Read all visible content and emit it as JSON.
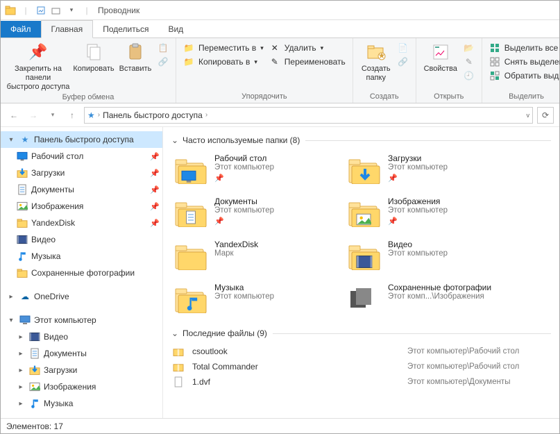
{
  "title": "Проводник",
  "tabs": {
    "file": "Файл",
    "home": "Главная",
    "share": "Поделиться",
    "view": "Вид"
  },
  "ribbon": {
    "clipboard": {
      "label": "Буфер обмена",
      "pin": "Закрепить на панели\nбыстрого доступа",
      "copy": "Копировать",
      "paste": "Вставить"
    },
    "organize": {
      "label": "Упорядочить",
      "move": "Переместить в",
      "copyto": "Копировать в",
      "delete": "Удалить",
      "rename": "Переименовать"
    },
    "new": {
      "label": "Создать",
      "newfolder": "Создать\nпапку"
    },
    "open": {
      "label": "Открыть",
      "props": "Свойства"
    },
    "select": {
      "label": "Выделить",
      "all": "Выделить все",
      "none": "Снять выделен",
      "invert": "Обратить выд"
    }
  },
  "breadcrumb": {
    "root": "Панель быстрого доступа"
  },
  "nav": {
    "quick": {
      "label": "Панель быстрого доступа",
      "items": [
        {
          "name": "Рабочий стол",
          "icon": "desktop",
          "pin": true
        },
        {
          "name": "Загрузки",
          "icon": "downloads",
          "pin": true
        },
        {
          "name": "Документы",
          "icon": "documents",
          "pin": true
        },
        {
          "name": "Изображения",
          "icon": "pictures",
          "pin": true
        },
        {
          "name": "YandexDisk",
          "icon": "folder",
          "pin": true
        },
        {
          "name": "Видео",
          "icon": "video",
          "pin": false
        },
        {
          "name": "Музыка",
          "icon": "music",
          "pin": false
        },
        {
          "name": "Сохраненные фотографии",
          "icon": "folder",
          "pin": false
        }
      ]
    },
    "onedrive": "OneDrive",
    "pc": {
      "label": "Этот компьютер",
      "items": [
        {
          "name": "Видео",
          "icon": "video"
        },
        {
          "name": "Документы",
          "icon": "documents"
        },
        {
          "name": "Загрузки",
          "icon": "downloads"
        },
        {
          "name": "Изображения",
          "icon": "pictures"
        },
        {
          "name": "Музыка",
          "icon": "music"
        }
      ]
    }
  },
  "content": {
    "folders": {
      "header": "Часто используемые папки (8)",
      "items": [
        {
          "name": "Рабочий стол",
          "sub": "Этот компьютер",
          "icon": "desktop",
          "pin": true
        },
        {
          "name": "Загрузки",
          "sub": "Этот компьютер",
          "icon": "downloads",
          "pin": true
        },
        {
          "name": "Документы",
          "sub": "Этот компьютер",
          "icon": "documents",
          "pin": true
        },
        {
          "name": "Изображения",
          "sub": "Этот компьютер",
          "icon": "pictures",
          "pin": true
        },
        {
          "name": "YandexDisk",
          "sub": "Марк",
          "icon": "folder",
          "pin": false
        },
        {
          "name": "Видео",
          "sub": "Этот компьютер",
          "icon": "video",
          "pin": false
        },
        {
          "name": "Музыка",
          "sub": "Этот компьютер",
          "icon": "music",
          "pin": false
        },
        {
          "name": "Сохраненные фотографии",
          "sub": "Этот комп...\\Изображения",
          "icon": "photos",
          "pin": false
        }
      ]
    },
    "files": {
      "header": "Последние файлы (9)",
      "items": [
        {
          "name": "csoutlook",
          "path": "Этот компьютер\\Рабочий стол",
          "icon": "zip"
        },
        {
          "name": "Total Commander",
          "path": "Этот компьютер\\Рабочий стол",
          "icon": "zip"
        },
        {
          "name": "1.dvf",
          "path": "Этот компьютер\\Документы",
          "icon": "file"
        }
      ]
    }
  },
  "status": "Элементов: 17"
}
